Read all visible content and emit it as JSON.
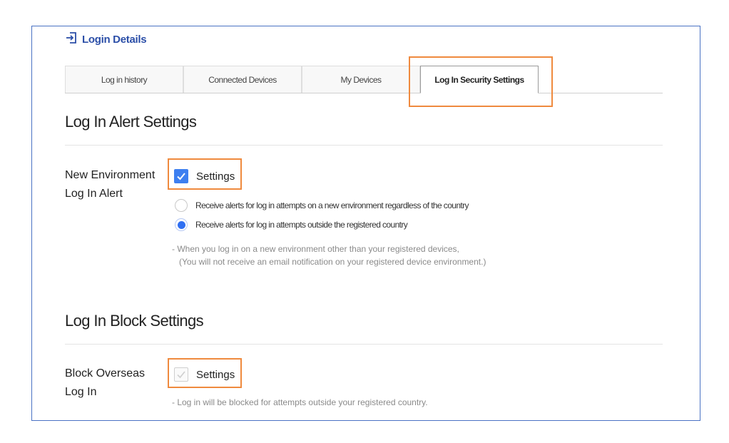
{
  "header": {
    "title": "Login Details",
    "icon": "login-arrow-icon"
  },
  "tabs": [
    {
      "label": "Log in history",
      "active": false
    },
    {
      "label": "Connected Devices",
      "active": false
    },
    {
      "label": "My Devices",
      "active": false
    },
    {
      "label": "Log In Security Settings",
      "active": true
    }
  ],
  "alert_section": {
    "title": "Log In Alert Settings",
    "row_label_line1": "New Environment",
    "row_label_line2": "Log In Alert",
    "checkbox_label": "Settings",
    "checkbox_checked": true,
    "options": [
      {
        "label": "Receive alerts for log in attempts on a new environment regardless of the country",
        "selected": false
      },
      {
        "label": "Receive alerts for log in attempts outside the registered country",
        "selected": true
      }
    ],
    "note_line1": "- When you log in on a new environment other than your registered devices,",
    "note_line2": "(You will not receive an email notification on your registered device environment.)"
  },
  "block_section": {
    "title": "Log In Block Settings",
    "row_label_line1": "Block Overseas",
    "row_label_line2": "Log In",
    "checkbox_label": "Settings",
    "checkbox_checked": false,
    "note": "- Log in will be blocked for attempts outside your registered country."
  },
  "colors": {
    "accent": "#3d7ff0",
    "highlight": "#ef8a3e",
    "frame": "#4a72c4",
    "header": "#2c4fa8"
  }
}
